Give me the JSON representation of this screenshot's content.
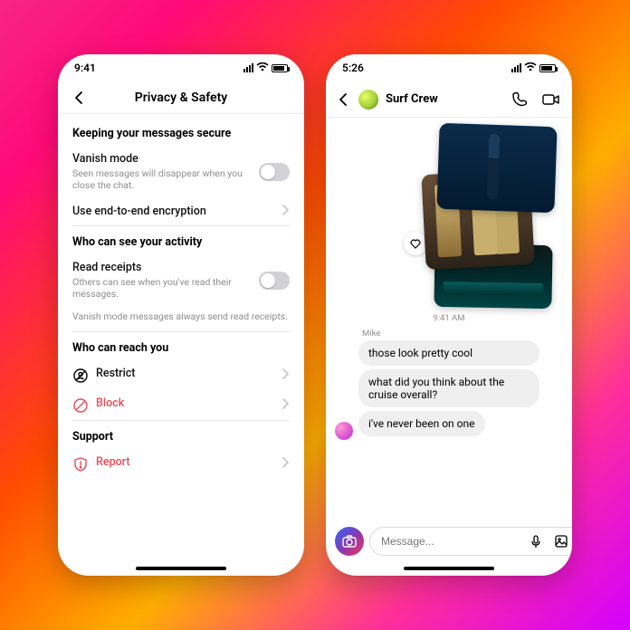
{
  "left": {
    "time": "9:41",
    "title": "Privacy & Safety",
    "sec1": "Keeping your messages secure",
    "vanish": {
      "label": "Vanish mode",
      "sub": "Seen messages will disappear when you close the chat."
    },
    "e2e": "Use end-to-end encryption",
    "sec2": "Who can see your activity",
    "read": {
      "label": "Read receipts",
      "sub": "Others can see when you've read their messages."
    },
    "note": "Vanish mode messages always send read receipts.",
    "sec3": "Who can reach you",
    "restrict": "Restrict",
    "block": "Block",
    "sec4": "Support",
    "report": "Report"
  },
  "right": {
    "time": "5:26",
    "title": "Surf Crew",
    "timestamp": "9:41 AM",
    "sender": "Mike",
    "msg1": "those look pretty cool",
    "msg2": "what did you think about the cruise overall?",
    "msg3": "i've never been on one",
    "placeholder": "Message..."
  }
}
